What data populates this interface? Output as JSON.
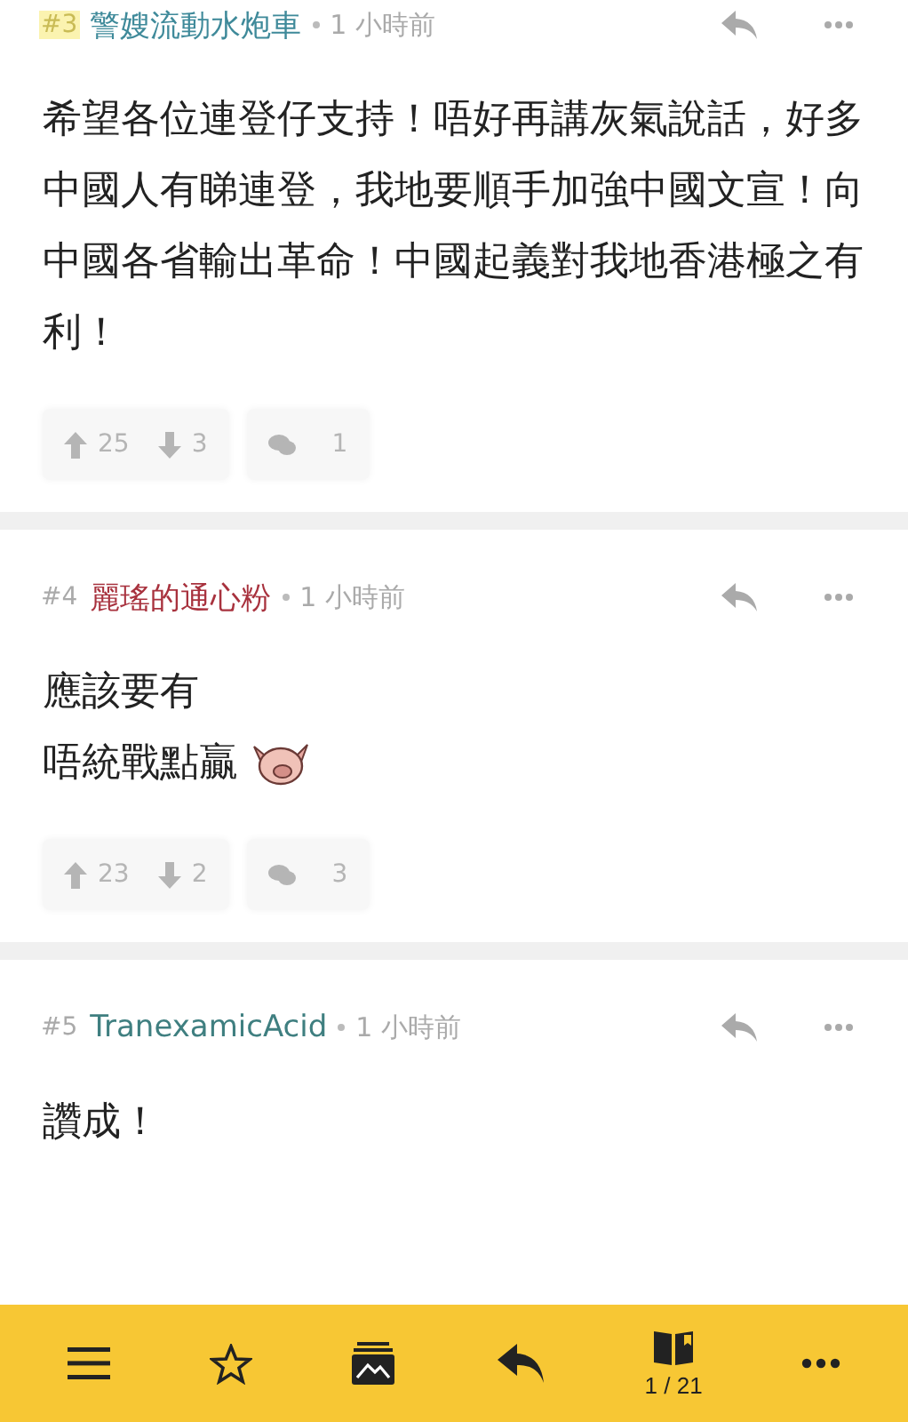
{
  "posts": [
    {
      "number": "#3",
      "author": "警嫂流動水炮車",
      "color": "#3f8a9a",
      "number_highlight": true,
      "time": "1 小時前",
      "lines": [
        {
          "kind": "text",
          "text": "希望各位連登仔支持！唔好再講灰氣說話，好多中國人有睇連登，我地要順手加強中國文宣！向中國各省輸出革命！中國起義對我地香港極之有利！"
        }
      ],
      "votes": {
        "up": "25",
        "down": "3",
        "comments": "1"
      }
    },
    {
      "number": "#4",
      "author": "麗瑤的通心粉",
      "color": "#a8323e",
      "number_highlight": false,
      "time": "1 小時前",
      "lines": [
        {
          "kind": "text",
          "text": "應該要有"
        },
        {
          "kind": "sticker",
          "text": "唔統戰點贏"
        }
      ],
      "votes": {
        "up": "23",
        "down": "2",
        "comments": "3"
      }
    },
    {
      "number": "#5",
      "author": "TranexamicAcid",
      "color": "#3f7f80",
      "number_highlight": false,
      "time": "1 小時前",
      "lines": [
        {
          "kind": "text",
          "text": "讚成！"
        }
      ]
    }
  ],
  "bottom_bar": {
    "page": "1 / 21"
  }
}
